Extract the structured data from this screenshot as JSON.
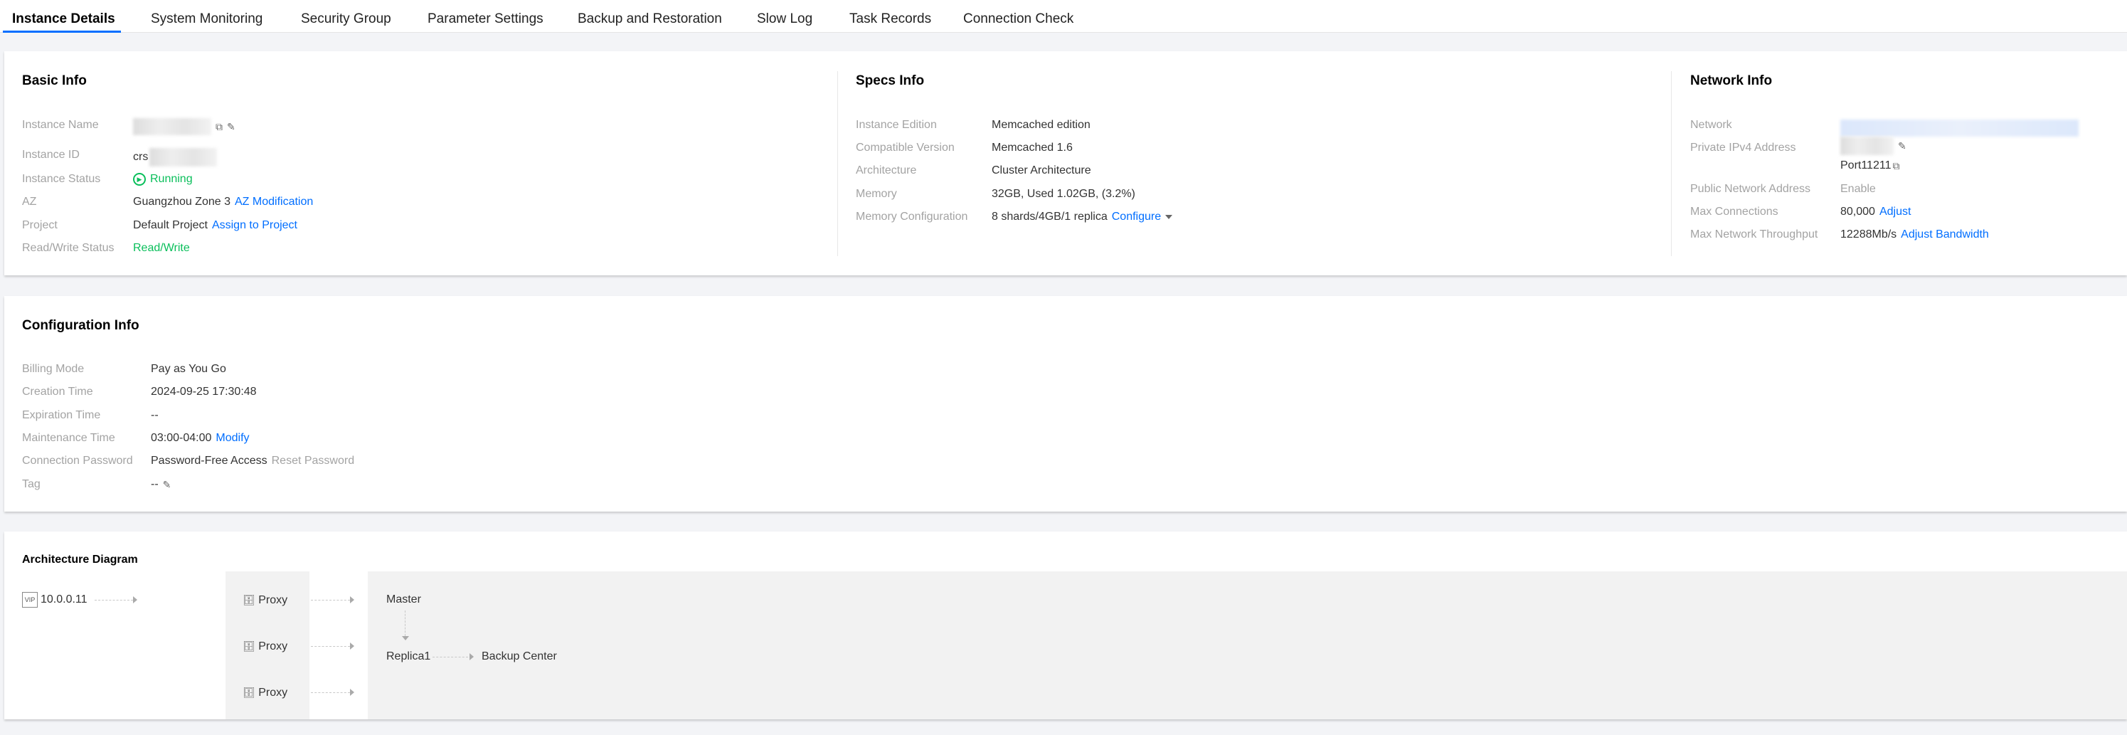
{
  "tabs": [
    "Instance Details",
    "System Monitoring",
    "Security Group",
    "Parameter Settings",
    "Backup and Restoration",
    "Slow Log",
    "Task Records",
    "Connection Check"
  ],
  "basic": {
    "title": "Basic Info",
    "labels": [
      "Instance Name",
      "Instance ID",
      "Instance Status",
      "AZ",
      "Project",
      "Read/Write Status"
    ],
    "instance_id_prefix": "crs",
    "status": "Running",
    "az": "Guangzhou Zone 3",
    "az_link": "AZ Modification",
    "project": "Default Project",
    "project_link": "Assign to Project",
    "rw_status": "Read/Write"
  },
  "specs": {
    "title": "Specs Info",
    "labels": [
      "Instance Edition",
      "Compatible Version",
      "Architecture",
      "Memory",
      "Memory Configuration"
    ],
    "values": [
      "Memcached edition",
      "Memcached 1.6",
      "Cluster Architecture",
      "32GB, Used 1.02GB, (3.2%)",
      "8 shards/4GB/1 replica"
    ],
    "configure_link": "Configure"
  },
  "network": {
    "title": "Network Info",
    "labels": [
      "Network",
      "Private IPv4 Address",
      "Public Network Address",
      "Max Connections",
      "Max Network Throughput"
    ],
    "port": "Port11211",
    "public": "Enable",
    "max_conn": "80,000",
    "max_conn_link": "Adjust",
    "throughput": "12288Mb/s",
    "throughput_link": "Adjust Bandwidth"
  },
  "config": {
    "title": "Configuration Info",
    "labels": [
      "Billing Mode",
      "Creation Time",
      "Expiration Time",
      "Maintenance Time",
      "Connection Password",
      "Tag"
    ],
    "values": [
      "Pay as You Go",
      "2024-09-25 17:30:48",
      "--",
      "03:00-04:00",
      "Password-Free Access",
      "--"
    ],
    "modify_link": "Modify",
    "reset_link": "Reset Password"
  },
  "arch": {
    "title": "Architecture Diagram",
    "vip_badge": "VIP",
    "vip": "10.0.0.11",
    "proxies": [
      "Proxy",
      "Proxy",
      "Proxy"
    ],
    "master": "Master",
    "replica": "Replica1",
    "backup": "Backup Center"
  }
}
